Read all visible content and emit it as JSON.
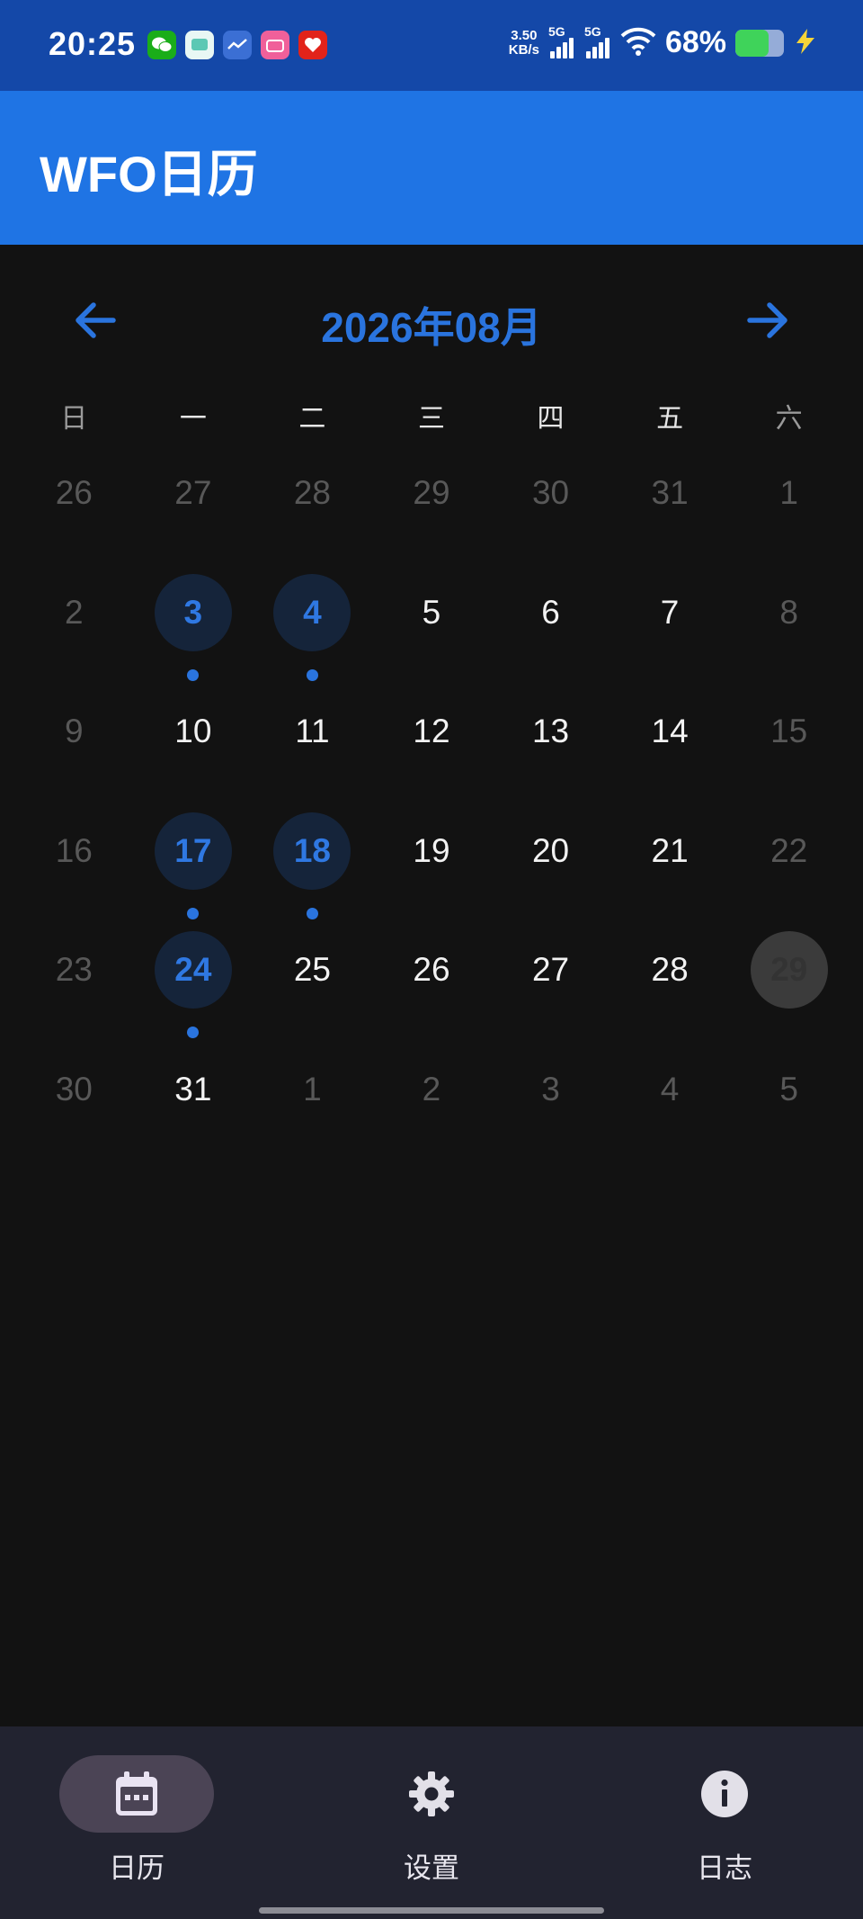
{
  "status_bar": {
    "time": "20:25",
    "net_speed_value": "3.50",
    "net_speed_unit": "KB/s",
    "signal1_label": "5G",
    "signal2_label": "5G",
    "battery_percent": "68%",
    "battery_level": 0.68,
    "app_icons": [
      "wechat-icon",
      "message-icon",
      "chart-app-icon",
      "bilibili-icon",
      "heart-app-icon"
    ],
    "colors": {
      "background": "#1448a8",
      "battery_fill": "#3fd35a"
    }
  },
  "app_bar": {
    "title": "WFO日历",
    "color": "#1f74e4"
  },
  "calendar": {
    "month_title": "2026年08月",
    "prev_icon": "arrow-left-icon",
    "next_icon": "arrow-right-icon",
    "weekdays": [
      "日",
      "一",
      "二",
      "三",
      "四",
      "五",
      "六"
    ],
    "weeks": [
      [
        {
          "day": "26",
          "type": "other"
        },
        {
          "day": "27",
          "type": "other"
        },
        {
          "day": "28",
          "type": "other"
        },
        {
          "day": "29",
          "type": "other"
        },
        {
          "day": "30",
          "type": "other"
        },
        {
          "day": "31",
          "type": "other"
        },
        {
          "day": "1",
          "type": "weekend"
        }
      ],
      [
        {
          "day": "2",
          "type": "weekend"
        },
        {
          "day": "3",
          "type": "wfo"
        },
        {
          "day": "4",
          "type": "wfo"
        },
        {
          "day": "5",
          "type": "normal"
        },
        {
          "day": "6",
          "type": "normal"
        },
        {
          "day": "7",
          "type": "normal"
        },
        {
          "day": "8",
          "type": "weekend"
        }
      ],
      [
        {
          "day": "9",
          "type": "weekend"
        },
        {
          "day": "10",
          "type": "normal"
        },
        {
          "day": "11",
          "type": "normal"
        },
        {
          "day": "12",
          "type": "normal"
        },
        {
          "day": "13",
          "type": "normal"
        },
        {
          "day": "14",
          "type": "normal"
        },
        {
          "day": "15",
          "type": "weekend"
        }
      ],
      [
        {
          "day": "16",
          "type": "weekend"
        },
        {
          "day": "17",
          "type": "wfo"
        },
        {
          "day": "18",
          "type": "wfo"
        },
        {
          "day": "19",
          "type": "normal"
        },
        {
          "day": "20",
          "type": "normal"
        },
        {
          "day": "21",
          "type": "normal"
        },
        {
          "day": "22",
          "type": "weekend"
        }
      ],
      [
        {
          "day": "23",
          "type": "weekend"
        },
        {
          "day": "24",
          "type": "wfo"
        },
        {
          "day": "25",
          "type": "normal"
        },
        {
          "day": "26",
          "type": "normal"
        },
        {
          "day": "27",
          "type": "normal"
        },
        {
          "day": "28",
          "type": "normal"
        },
        {
          "day": "29",
          "type": "today"
        }
      ],
      [
        {
          "day": "30",
          "type": "other"
        },
        {
          "day": "31",
          "type": "normal"
        },
        {
          "day": "1",
          "type": "other"
        },
        {
          "day": "2",
          "type": "other"
        },
        {
          "day": "3",
          "type": "other"
        },
        {
          "day": "4",
          "type": "other"
        },
        {
          "day": "5",
          "type": "other"
        }
      ]
    ],
    "colors": {
      "accent": "#2a74de",
      "wfo_bg": "#15243a",
      "today_bg": "#3b3b3b"
    }
  },
  "bottom_nav": {
    "items": [
      {
        "label": "日历",
        "icon": "calendar-icon",
        "active": true
      },
      {
        "label": "设置",
        "icon": "gear-icon",
        "active": false
      },
      {
        "label": "日志",
        "icon": "info-icon",
        "active": false
      }
    ]
  }
}
